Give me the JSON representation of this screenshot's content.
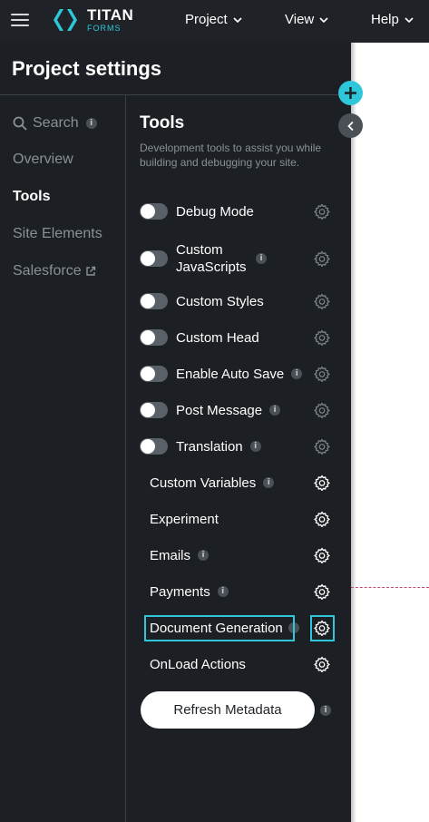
{
  "header": {
    "brand_title": "TITAN",
    "brand_sub": "FORMS",
    "menus": [
      {
        "label": "Project"
      },
      {
        "label": "View"
      },
      {
        "label": "Help"
      }
    ]
  },
  "panel": {
    "title": "Project settings",
    "nav": [
      {
        "label": "Search",
        "icon": "search-icon",
        "info": "i"
      },
      {
        "label": "Overview"
      },
      {
        "label": "Tools",
        "active": true
      },
      {
        "label": "Site Elements"
      },
      {
        "label": "Salesforce",
        "icon": "external-link-icon"
      }
    ]
  },
  "tools": {
    "title": "Tools",
    "description": "Development tools to assist you while building and debugging your site.",
    "toggles": [
      {
        "label": "Debug Mode",
        "on": false
      },
      {
        "label": "Custom JavaScripts",
        "on": false,
        "info": "i"
      },
      {
        "label": "Custom Styles",
        "on": false
      },
      {
        "label": "Custom Head",
        "on": false
      },
      {
        "label": "Enable Auto Save",
        "on": false,
        "info": "i"
      },
      {
        "label": "Post Message",
        "on": false,
        "info": "i"
      },
      {
        "label": "Translation",
        "on": false,
        "info": "i"
      }
    ],
    "items": [
      {
        "label": "Custom Variables",
        "info": "i"
      },
      {
        "label": "Experiment"
      },
      {
        "label": "Emails",
        "info": "i"
      },
      {
        "label": "Payments",
        "info": "i"
      },
      {
        "label": "Document Generation",
        "info": "i",
        "highlighted": true
      },
      {
        "label": "OnLoad Actions"
      }
    ],
    "refresh_label": "Refresh Metadata",
    "refresh_info": "i"
  },
  "colors": {
    "accent": "#2ec7da",
    "panel_bg": "#1c2024",
    "header_bg": "#1f2327"
  }
}
